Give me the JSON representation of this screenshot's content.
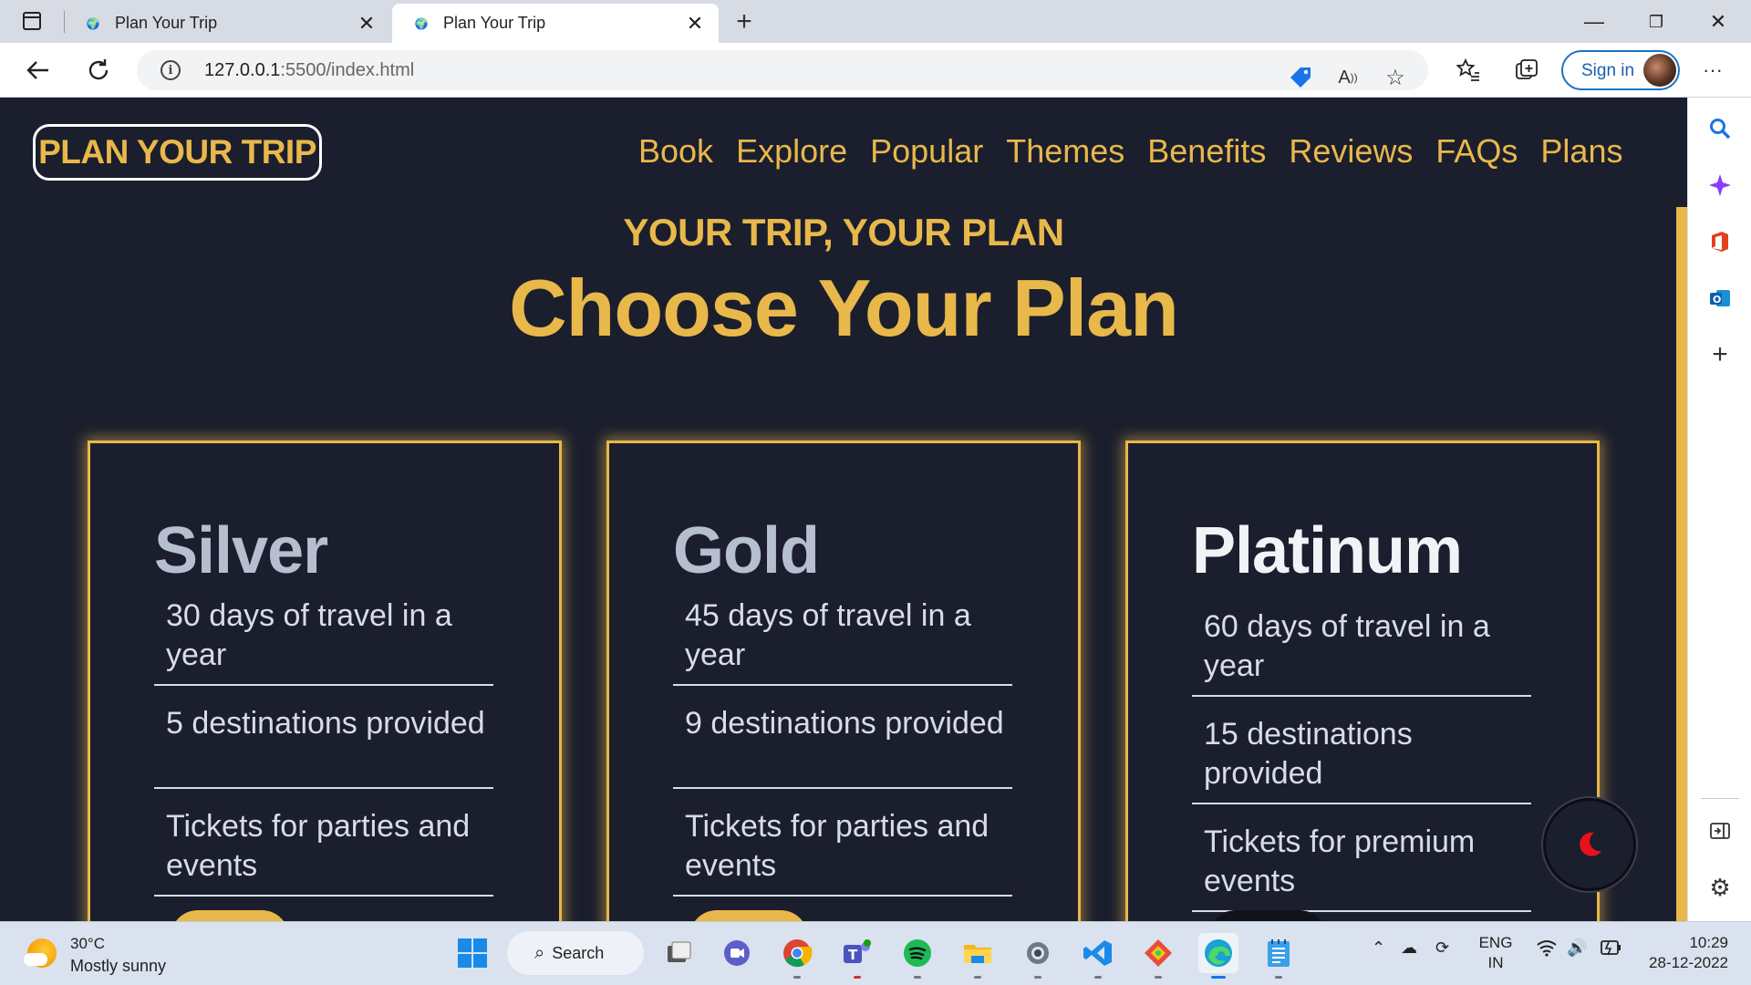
{
  "browser": {
    "tabs": [
      {
        "title": "Plan Your Trip",
        "active": false
      },
      {
        "title": "Plan Your Trip",
        "active": true
      }
    ],
    "url_host": "127.0.0.1",
    "url_rest": ":5500/index.html",
    "sign_in_label": "Sign in"
  },
  "site": {
    "brand": "PLAN YOUR TRIP",
    "nav": [
      "Book",
      "Explore",
      "Popular",
      "Themes",
      "Benefits",
      "Reviews",
      "FAQs",
      "Plans"
    ],
    "kicker": "YOUR TRIP, YOUR PLAN",
    "title": "Choose Your Plan",
    "accent_color": "#e8b84a",
    "plans": [
      {
        "name": "Silver",
        "features": [
          "30 days of travel in a year",
          "5 destinations provided",
          "Tickets for parties and events"
        ]
      },
      {
        "name": "Gold",
        "features": [
          "45 days of travel in a year",
          "9 destinations provided",
          "Tickets for parties and events"
        ]
      },
      {
        "name": "Platinum",
        "features": [
          "60 days of travel in a year",
          "15 destinations provided",
          "Tickets for premium events"
        ]
      }
    ],
    "theme_toggle_icon": "moon-icon"
  },
  "taskbar": {
    "weather_temp": "30°C",
    "weather_desc": "Mostly sunny",
    "search_label": "Search",
    "lang_line1": "ENG",
    "lang_line2": "IN",
    "time": "10:29",
    "date": "28-12-2022"
  }
}
